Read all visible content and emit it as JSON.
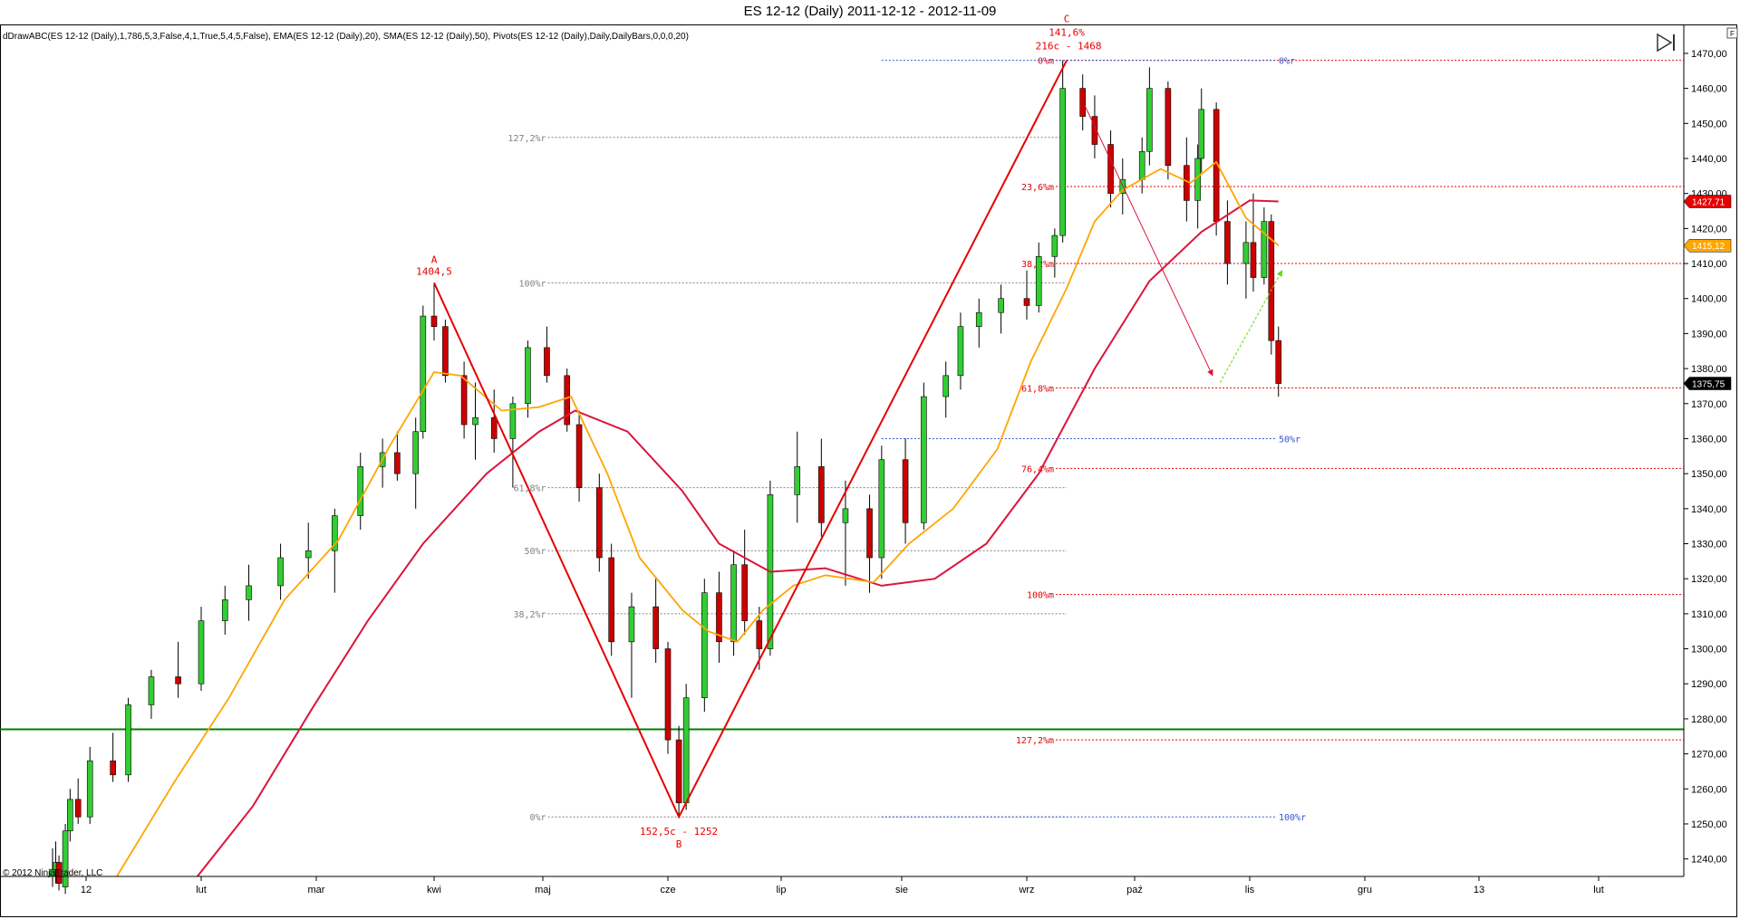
{
  "window": {
    "title": "ES 12-12 (Daily)  2011-12-12 - 2012-11-09",
    "indicator_line": "dDrawABC(ES 12-12 (Daily),1,786,5,3,False,4,1,True,5,4,5,False), EMA(ES 12-12 (Daily),20), SMA(ES 12-12 (Daily),50), Pivots(ES 12-12 (Daily),Daily,DailyBars,0,0,0,20)",
    "copyright": "© 2012 NinjaTrader, LLC",
    "corner_button": "F",
    "jump_icon": "skip-to-end-icon"
  },
  "colors": {
    "up_candle": "#32cd32",
    "down_candle": "#cc0000",
    "ema": "#ffa500",
    "sma": "#dc143c",
    "abc": "#e60000",
    "support": "#008000",
    "retrace_gray": "#808080",
    "retrace_blue": "#3355cc"
  },
  "chart_data": {
    "type": "candlestick",
    "instrument": "ES 12-12 (Daily)",
    "date_range": [
      "2011-12-12",
      "2012-11-09"
    ],
    "y_axis": {
      "min": 1235,
      "max": 1478,
      "ticks": [
        1240,
        1250,
        1260,
        1270,
        1280,
        1290,
        1300,
        1310,
        1320,
        1330,
        1340,
        1350,
        1360,
        1370,
        1380,
        1390,
        1400,
        1410,
        1420,
        1430,
        1440,
        1450,
        1460,
        1470
      ]
    },
    "x_axis": {
      "labels": [
        {
          "label": "12",
          "date": "2012-01-02"
        },
        {
          "label": "lut",
          "date": "2012-02-01"
        },
        {
          "label": "mar",
          "date": "2012-03-01"
        },
        {
          "label": "kwi",
          "date": "2012-04-02"
        },
        {
          "label": "maj",
          "date": "2012-05-01"
        },
        {
          "label": "cze",
          "date": "2012-06-01"
        },
        {
          "label": "lip",
          "date": "2012-07-02"
        },
        {
          "label": "sie",
          "date": "2012-08-01"
        },
        {
          "label": "wrz",
          "date": "2012-09-04"
        },
        {
          "label": "paź",
          "date": "2012-10-01"
        },
        {
          "label": "lis",
          "date": "2012-11-01"
        },
        {
          "label": "gru",
          "date": "2012-12-03"
        },
        {
          "label": "13",
          "date": "2013-01-02"
        },
        {
          "label": "lut",
          "date": "2013-02-01"
        }
      ]
    },
    "price_markers": [
      {
        "value": "1427,71",
        "price": 1427.71,
        "color": "#e60000"
      },
      {
        "value": "1415,12",
        "price": 1415.12,
        "color": "#ffa500"
      },
      {
        "value": "1375,75",
        "price": 1375.75,
        "color": "#000000"
      }
    ],
    "abc_pattern": {
      "A": {
        "label": "A",
        "value_text": "1404,5",
        "date": "2012-04-02",
        "price": 1404.5
      },
      "B": {
        "label": "B",
        "value_text": "152,5c - 1252",
        "date": "2012-06-04",
        "price": 1252
      },
      "C": {
        "label": "C",
        "value_text_1": "141,6%",
        "value_text_2": "216c - 1468",
        "date": "2012-09-14",
        "price": 1468
      }
    },
    "retracement_levels_r": [
      {
        "label": "127,2%r",
        "price": 1446,
        "color": "#808080"
      },
      {
        "label": "100%r",
        "price": 1404.5,
        "color": "#808080"
      },
      {
        "label": "61,8%r",
        "price": 1346,
        "color": "#808080"
      },
      {
        "label": "50%r",
        "price": 1328,
        "color": "#808080"
      },
      {
        "label": "38,2%r",
        "price": 1310,
        "color": "#808080"
      },
      {
        "label": "0%r",
        "price": 1252,
        "color": "#808080"
      }
    ],
    "extension_levels_m": [
      {
        "label": "0%m",
        "price": 1468
      },
      {
        "label": "23,6%m",
        "price": 1432
      },
      {
        "label": "38,2%m",
        "price": 1410
      },
      {
        "label": "61,8%m",
        "price": 1374.5
      },
      {
        "label": "76,4%m",
        "price": 1351.5
      },
      {
        "label": "100%m",
        "price": 1315.5
      },
      {
        "label": "127,2%m",
        "price": 1274
      }
    ],
    "blue_levels": [
      {
        "label": "0%r",
        "price": 1468
      },
      {
        "label": "50%r",
        "price": 1360
      },
      {
        "label": "100%r",
        "price": 1252
      }
    ],
    "support_line": {
      "price": 1277
    },
    "ema20_points": [
      [
        "2012-01-10",
        1235
      ],
      [
        "2012-01-25",
        1262
      ],
      [
        "2012-02-08",
        1286
      ],
      [
        "2012-02-22",
        1314
      ],
      [
        "2012-03-07",
        1331
      ],
      [
        "2012-03-21",
        1358
      ],
      [
        "2012-04-02",
        1379
      ],
      [
        "2012-04-09",
        1378
      ],
      [
        "2012-04-20",
        1368
      ],
      [
        "2012-04-30",
        1369
      ],
      [
        "2012-05-08",
        1372
      ],
      [
        "2012-05-17",
        1350
      ],
      [
        "2012-05-25",
        1326
      ],
      [
        "2012-06-05",
        1311
      ],
      [
        "2012-06-12",
        1305
      ],
      [
        "2012-06-20",
        1302
      ],
      [
        "2012-06-27",
        1311
      ],
      [
        "2012-07-05",
        1318
      ],
      [
        "2012-07-13",
        1321
      ],
      [
        "2012-07-25",
        1319
      ],
      [
        "2012-08-03",
        1330
      ],
      [
        "2012-08-15",
        1340
      ],
      [
        "2012-08-27",
        1357
      ],
      [
        "2012-09-05",
        1382
      ],
      [
        "2012-09-14",
        1403
      ],
      [
        "2012-09-21",
        1422
      ],
      [
        "2012-09-28",
        1431
      ],
      [
        "2012-10-08",
        1437
      ],
      [
        "2012-10-16",
        1433
      ],
      [
        "2012-10-23",
        1439
      ],
      [
        "2012-10-31",
        1423
      ],
      [
        "2012-11-09",
        1415.12
      ]
    ],
    "sma50_points": [
      [
        "2012-01-31",
        1235
      ],
      [
        "2012-02-14",
        1255
      ],
      [
        "2012-02-29",
        1283
      ],
      [
        "2012-03-15",
        1308
      ],
      [
        "2012-03-30",
        1330
      ],
      [
        "2012-04-16",
        1350
      ],
      [
        "2012-04-30",
        1362
      ],
      [
        "2012-05-09",
        1368
      ],
      [
        "2012-05-22",
        1362
      ],
      [
        "2012-06-05",
        1345
      ],
      [
        "2012-06-15",
        1330
      ],
      [
        "2012-06-29",
        1322
      ],
      [
        "2012-07-13",
        1323
      ],
      [
        "2012-07-27",
        1318
      ],
      [
        "2012-08-10",
        1320
      ],
      [
        "2012-08-24",
        1330
      ],
      [
        "2012-09-07",
        1350
      ],
      [
        "2012-09-21",
        1380
      ],
      [
        "2012-10-05",
        1405
      ],
      [
        "2012-10-19",
        1419
      ],
      [
        "2012-11-01",
        1428
      ],
      [
        "2012-11-09",
        1427.71
      ]
    ],
    "candles": [
      [
        "2011-12-12",
        1235,
        1243,
        1232,
        1237
      ],
      [
        "2011-12-14",
        1237,
        1245,
        1233,
        1239
      ],
      [
        "2011-12-16",
        1239,
        1241,
        1231,
        1233
      ],
      [
        "2011-12-20",
        1232,
        1250,
        1230,
        1248
      ],
      [
        "2011-12-23",
        1248,
        1260,
        1245,
        1257
      ],
      [
        "2011-12-28",
        1257,
        1263,
        1250,
        1252
      ],
      [
        "2012-01-03",
        1252,
        1272,
        1250,
        1268
      ],
      [
        "2012-01-09",
        1268,
        1276,
        1262,
        1264
      ],
      [
        "2012-01-13",
        1264,
        1286,
        1262,
        1284
      ],
      [
        "2012-01-19",
        1284,
        1294,
        1280,
        1292
      ],
      [
        "2012-01-26",
        1292,
        1302,
        1286,
        1290
      ],
      [
        "2012-02-01",
        1290,
        1312,
        1288,
        1308
      ],
      [
        "2012-02-07",
        1308,
        1318,
        1304,
        1314
      ],
      [
        "2012-02-13",
        1314,
        1324,
        1308,
        1318
      ],
      [
        "2012-02-21",
        1318,
        1330,
        1314,
        1326
      ],
      [
        "2012-02-28",
        1326,
        1336,
        1320,
        1328
      ],
      [
        "2012-03-06",
        1328,
        1340,
        1316,
        1338
      ],
      [
        "2012-03-13",
        1338,
        1356,
        1334,
        1352
      ],
      [
        "2012-03-19",
        1352,
        1360,
        1346,
        1356
      ],
      [
        "2012-03-23",
        1356,
        1362,
        1348,
        1350
      ],
      [
        "2012-03-28",
        1350,
        1366,
        1340,
        1362
      ],
      [
        "2012-03-30",
        1362,
        1398,
        1360,
        1395
      ],
      [
        "2012-04-02",
        1395,
        1404.5,
        1388,
        1392
      ],
      [
        "2012-04-05",
        1392,
        1394,
        1376,
        1378
      ],
      [
        "2012-04-10",
        1378,
        1382,
        1360,
        1364
      ],
      [
        "2012-04-13",
        1364,
        1376,
        1354,
        1366
      ],
      [
        "2012-04-18",
        1366,
        1374,
        1356,
        1360
      ],
      [
        "2012-04-23",
        1360,
        1372,
        1346,
        1370
      ],
      [
        "2012-04-27",
        1370,
        1388,
        1366,
        1386
      ],
      [
        "2012-05-02",
        1386,
        1392,
        1376,
        1378
      ],
      [
        "2012-05-07",
        1378,
        1380,
        1362,
        1364
      ],
      [
        "2012-05-10",
        1364,
        1368,
        1342,
        1346
      ],
      [
        "2012-05-15",
        1346,
        1350,
        1322,
        1326
      ],
      [
        "2012-05-18",
        1326,
        1330,
        1298,
        1302
      ],
      [
        "2012-05-23",
        1302,
        1316,
        1286,
        1312
      ],
      [
        "2012-05-29",
        1312,
        1320,
        1296,
        1300
      ],
      [
        "2012-06-01",
        1300,
        1302,
        1270,
        1274
      ],
      [
        "2012-06-04",
        1274,
        1278,
        1252,
        1256
      ],
      [
        "2012-06-06",
        1256,
        1290,
        1254,
        1286
      ],
      [
        "2012-06-11",
        1286,
        1320,
        1282,
        1316
      ],
      [
        "2012-06-15",
        1316,
        1322,
        1296,
        1302
      ],
      [
        "2012-06-19",
        1302,
        1328,
        1298,
        1324
      ],
      [
        "2012-06-22",
        1324,
        1334,
        1304,
        1308
      ],
      [
        "2012-06-26",
        1308,
        1312,
        1294,
        1300
      ],
      [
        "2012-06-29",
        1300,
        1348,
        1298,
        1344
      ],
      [
        "2012-07-06",
        1344,
        1362,
        1336,
        1352
      ],
      [
        "2012-07-12",
        1352,
        1360,
        1332,
        1336
      ],
      [
        "2012-07-18",
        1336,
        1348,
        1318,
        1340
      ],
      [
        "2012-07-24",
        1340,
        1344,
        1316,
        1326
      ],
      [
        "2012-07-27",
        1326,
        1358,
        1320,
        1354
      ],
      [
        "2012-08-02",
        1354,
        1360,
        1330,
        1336
      ],
      [
        "2012-08-07",
        1336,
        1376,
        1334,
        1372
      ],
      [
        "2012-08-13",
        1372,
        1382,
        1366,
        1378
      ],
      [
        "2012-08-17",
        1378,
        1396,
        1374,
        1392
      ],
      [
        "2012-08-22",
        1392,
        1400,
        1386,
        1396
      ],
      [
        "2012-08-28",
        1396,
        1404,
        1390,
        1400
      ],
      [
        "2012-09-04",
        1400,
        1408,
        1394,
        1398
      ],
      [
        "2012-09-07",
        1398,
        1416,
        1396,
        1412
      ],
      [
        "2012-09-11",
        1412,
        1420,
        1406,
        1418
      ],
      [
        "2012-09-13",
        1418,
        1468,
        1416,
        1460
      ],
      [
        "2012-09-18",
        1460,
        1464,
        1448,
        1452
      ],
      [
        "2012-09-21",
        1452,
        1458,
        1440,
        1444
      ],
      [
        "2012-09-25",
        1444,
        1448,
        1426,
        1430
      ],
      [
        "2012-09-28",
        1430,
        1440,
        1424,
        1434
      ],
      [
        "2012-10-03",
        1434,
        1446,
        1430,
        1442
      ],
      [
        "2012-10-05",
        1442,
        1466,
        1438,
        1460
      ],
      [
        "2012-10-10",
        1460,
        1462,
        1434,
        1438
      ],
      [
        "2012-10-15",
        1438,
        1446,
        1422,
        1428
      ],
      [
        "2012-10-18",
        1428,
        1444,
        1420,
        1440
      ],
      [
        "2012-10-19",
        1440,
        1460,
        1436,
        1454
      ],
      [
        "2012-10-23",
        1454,
        1456,
        1418,
        1422
      ],
      [
        "2012-10-26",
        1422,
        1428,
        1404,
        1410
      ],
      [
        "2012-10-31",
        1410,
        1422,
        1400,
        1416
      ],
      [
        "2012-11-02",
        1416,
        1430,
        1402,
        1406
      ],
      [
        "2012-11-05",
        1406,
        1426,
        1404,
        1422
      ],
      [
        "2012-11-07",
        1422,
        1424,
        1384,
        1388
      ],
      [
        "2012-11-09",
        1388,
        1392,
        1372,
        1375.75
      ]
    ]
  }
}
